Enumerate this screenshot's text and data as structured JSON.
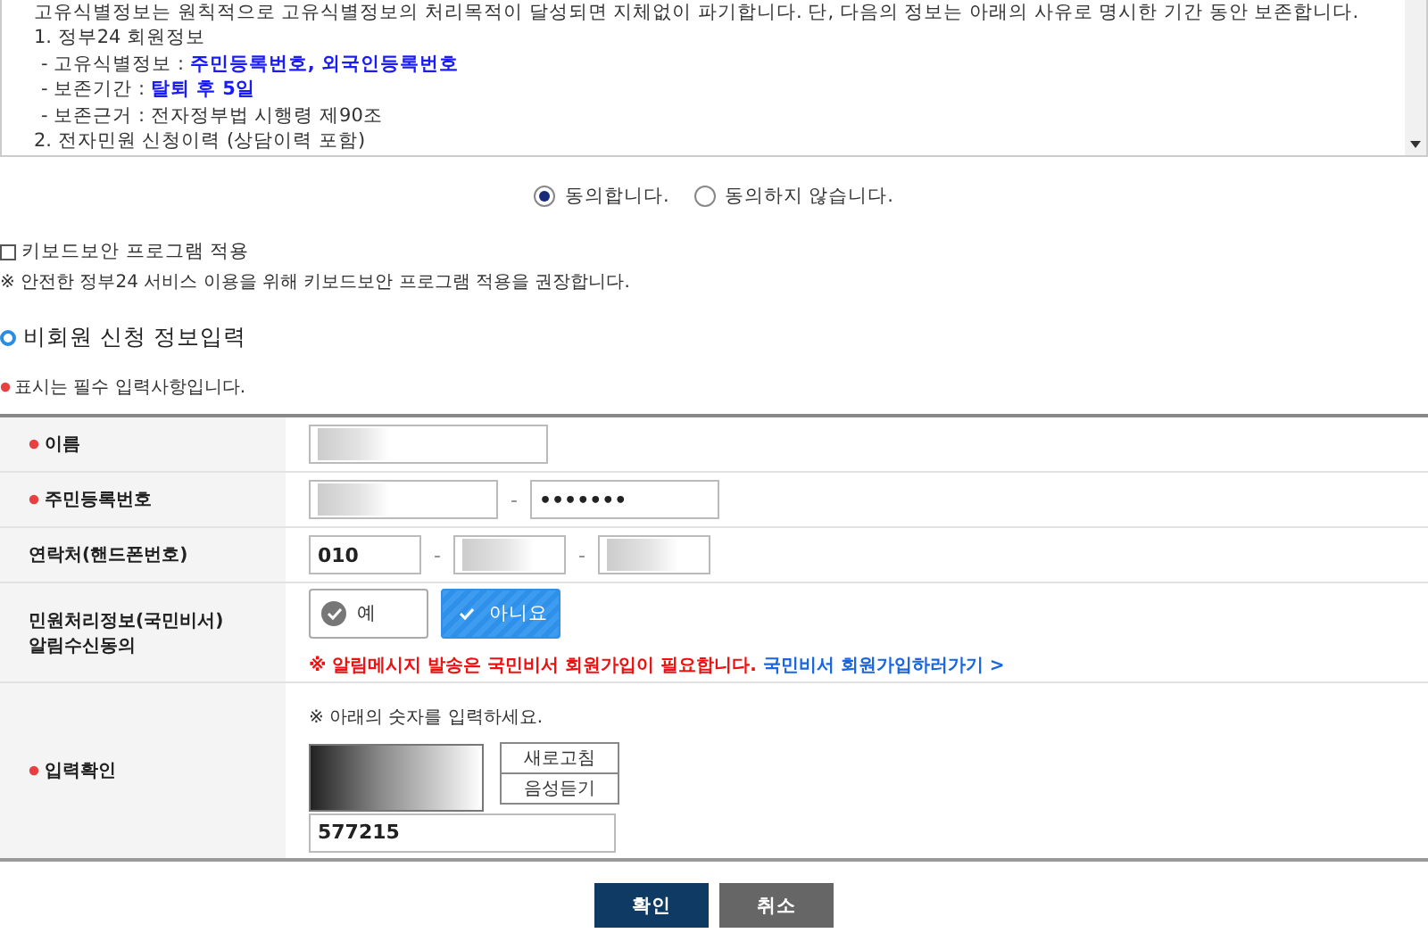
{
  "notice_box": {
    "lines": [
      {
        "kind": "plain",
        "text": "고유식별정보는 원칙적으로 고유식별정보의 처리목적이 달성되면 지체없이 파기합니다. 단, 다음의 정보는 아래의 사유로 명시한 기간 동안 보존합니다."
      },
      {
        "kind": "plain",
        "text": "1. 정부24 회원정보"
      },
      {
        "kind": "item",
        "text": " - 고유식별정보 : ",
        "highlight": "주민등록번호, 외국인등록번호"
      },
      {
        "kind": "item",
        "text": " - 보존기간 : ",
        "highlight": "탈퇴 후 5일"
      },
      {
        "kind": "item",
        "text": " - 보존근거 : 전자정부법 시행령 제90조"
      },
      {
        "kind": "plain",
        "text": "2. 전자민원 신청이력 (상담이력 포함)"
      }
    ]
  },
  "consent": {
    "options": [
      {
        "label": "동의합니다.",
        "selected": true
      },
      {
        "label": "동의하지 않습니다.",
        "selected": false
      }
    ]
  },
  "keyboard_security": {
    "label": "키보드보안 프로그램 적용",
    "checked": false,
    "note": "※ 안전한 정부24 서비스 이용을 위해 키보드보안 프로그램 적용을 권장합니다."
  },
  "section_title": "비회원 신청 정보입력",
  "required_note": "표시는 필수 입력사항입니다.",
  "form_rows": [
    {
      "kind": "inputs",
      "label": "이름",
      "required": true,
      "fields": [
        {
          "redacted": true
        }
      ]
    },
    {
      "kind": "inputs",
      "label": "주민등록번호",
      "required": true,
      "separator": "-",
      "fields": [
        {
          "redacted": true
        },
        {
          "value": "•••••••"
        }
      ]
    },
    {
      "kind": "inputs",
      "label": "연락처(핸드폰번호)",
      "required": false,
      "separator": "-",
      "fields": [
        {
          "value": "010"
        },
        {
          "redacted": true
        },
        {
          "redacted": true
        }
      ]
    },
    {
      "kind": "choice",
      "label_lines": [
        "민원처리정보(국민비서)",
        "알림수신동의"
      ],
      "required": false,
      "options": [
        {
          "label": "예",
          "selected": false
        },
        {
          "label": "아니요",
          "selected": true
        }
      ],
      "warning": "※  알림메시지 발송은 국민비서 회원가입이 필요합니다.",
      "link": "국민비서 회원가입하러가기 >"
    },
    {
      "kind": "captcha",
      "label": "입력확인",
      "required": true,
      "instruction": "※ 아래의 숫자를 입력하세요.",
      "buttons": [
        "새로고침",
        "음성듣기"
      ],
      "value": "577215"
    }
  ],
  "buttons": [
    {
      "label": "확인",
      "kind": "primary"
    },
    {
      "label": "취소",
      "kind": "secondary"
    }
  ]
}
